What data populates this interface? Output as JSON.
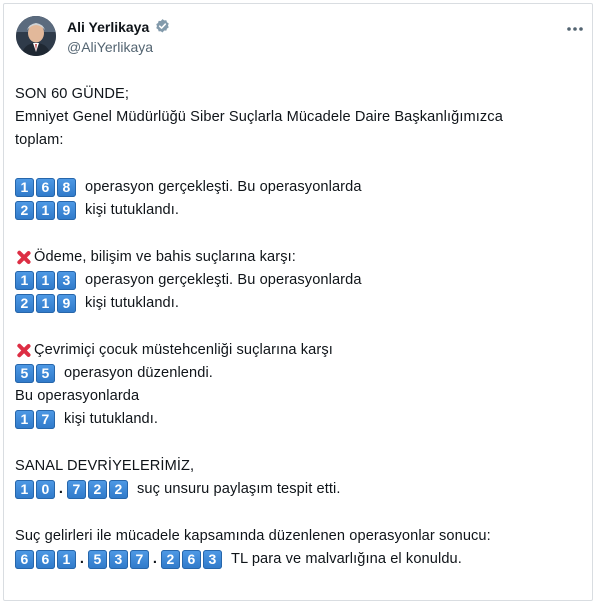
{
  "author": {
    "display_name": "Ali Yerlikaya",
    "handle": "@AliYerlikaya"
  },
  "tweet": {
    "intro": [
      "SON 60 GÜNDE;",
      "Emniyet Genel Müdürlüğü Siber Suçlarla Mücadele Daire Başkanlığımızca",
      "toplam:"
    ],
    "total": {
      "operations_digits": [
        "1",
        "6",
        "8"
      ],
      "operations_text": "operasyon gerçekleşti. Bu operasyonlarda",
      "arrests_digits": [
        "2",
        "1",
        "9"
      ],
      "arrests_text": "kişi tutuklandı."
    },
    "betting": {
      "heading": "Ödeme, bilişim ve bahis suçlarına karşı:",
      "operations_digits": [
        "1",
        "1",
        "3"
      ],
      "operations_text": "operasyon gerçekleşti. Bu operasyonlarda",
      "arrests_digits": [
        "2",
        "1",
        "9"
      ],
      "arrests_text": "kişi tutuklandı."
    },
    "child": {
      "heading": "Çevrimiçi çocuk müstehcenliği suçlarına karşı",
      "operations_digits": [
        "5",
        "5"
      ],
      "operations_text": "operasyon düzenlendi.",
      "middle": "Bu operasyonlarda",
      "arrests_digits": [
        "1",
        "7"
      ],
      "arrests_text": "kişi tutuklandı."
    },
    "patrol": {
      "heading": "SANAL DEVRİYELERİMİZ,",
      "digits": [
        "1",
        "0",
        ".",
        "7",
        "2",
        "2"
      ],
      "text": "suç unsuru paylaşım tespit etti."
    },
    "proceeds": {
      "heading": "Suç gelirleri ile mücadele kapsamında düzenlenen operasyonlar sonucu:",
      "digits": [
        "6",
        "6",
        "1",
        ".",
        "5",
        "3",
        "7",
        ".",
        "2",
        "6",
        "3"
      ],
      "text": "TL para ve malvarlığına el konuldu."
    }
  },
  "icons": {
    "verified": "verified-badge-icon",
    "more": "more-options-icon",
    "cross": "cross-mark-icon"
  },
  "colors": {
    "keycap": "#3b88d8",
    "verified_badge": "#829aab",
    "cross": "#dd2e44"
  }
}
